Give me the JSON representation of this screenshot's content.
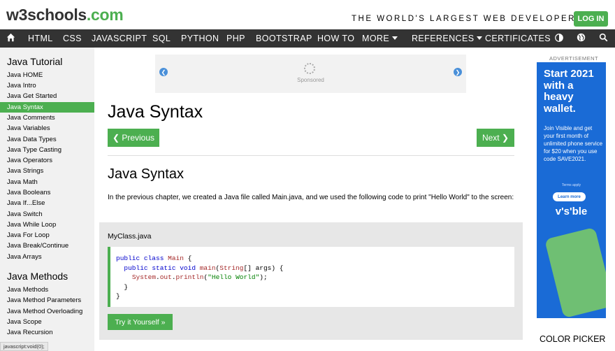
{
  "header": {
    "logo_main": "w3schools",
    "logo_accent": ".com",
    "tagline": "THE WORLD'S LARGEST WEB DEVELOPER SITE",
    "login": "LOG IN"
  },
  "nav": {
    "items": [
      "HTML",
      "CSS",
      "JAVASCRIPT",
      "SQL",
      "PYTHON",
      "PHP",
      "BOOTSTRAP",
      "HOW TO",
      "MORE",
      "REFERENCES",
      "CERTIFICATES"
    ]
  },
  "sidebar": {
    "heading1": "Java Tutorial",
    "items1": [
      "Java HOME",
      "Java Intro",
      "Java Get Started",
      "Java Syntax",
      "Java Comments",
      "Java Variables",
      "Java Data Types",
      "Java Type Casting",
      "Java Operators",
      "Java Strings",
      "Java Math",
      "Java Booleans",
      "Java If...Else",
      "Java Switch",
      "Java While Loop",
      "Java For Loop",
      "Java Break/Continue",
      "Java Arrays"
    ],
    "heading2": "Java Methods",
    "items2": [
      "Java Methods",
      "Java Method Parameters",
      "Java Method Overloading",
      "Java Scope",
      "Java Recursion"
    ]
  },
  "main": {
    "sponsored": "Sponsored",
    "title": "Java Syntax",
    "previous": "❮ Previous",
    "next": "Next ❯",
    "h2": "Java Syntax",
    "paragraph": "In the previous chapter, we created a Java file called Main.java, and we used the following code to print \"Hello World\" to the screen:",
    "example_file": "MyClass.java",
    "try_button": "Try it Yourself »"
  },
  "ad": {
    "label": "ADVERTISEMENT",
    "headline": "Start 2021 with a heavy wallet.",
    "body": "Join Visible and get your first month of unlimited phone service for $20 when you use code SAVE2021.",
    "terms": "Terms apply",
    "learn": "Learn more",
    "brand": "v's'ble"
  },
  "color_picker": "COLOR PICKER",
  "status": "javascript:void(0);",
  "colors": {
    "accent": "#4CAF50",
    "nav_bg": "#333333",
    "ad_bg": "#1a6bd6"
  }
}
